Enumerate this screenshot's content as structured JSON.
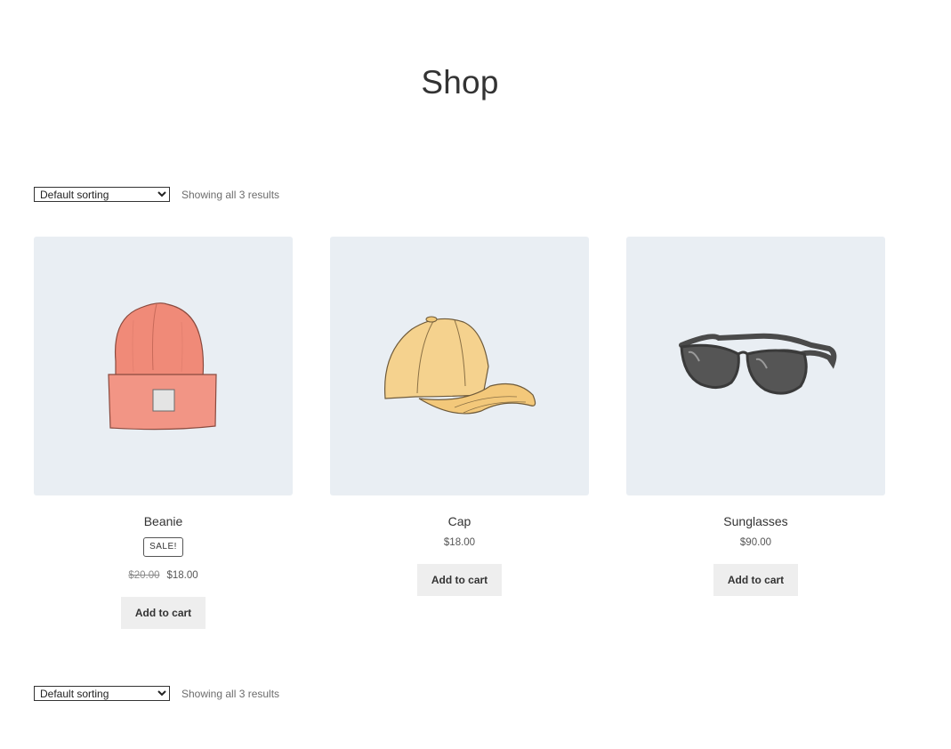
{
  "page": {
    "title": "Shop"
  },
  "toolbar_top": {
    "sort_selected": "Default sorting",
    "result_count": "Showing all 3 results"
  },
  "toolbar_bottom": {
    "sort_selected": "Default sorting",
    "result_count": "Showing all 3 results"
  },
  "products": [
    {
      "name": "Beanie",
      "icon": "beanie-hat-image",
      "sale_badge": "SALE!",
      "old_price": "$20.00",
      "price": "$18.00",
      "button_label": "Add to cart"
    },
    {
      "name": "Cap",
      "icon": "baseball-cap-image",
      "price": "$18.00",
      "button_label": "Add to cart"
    },
    {
      "name": "Sunglasses",
      "icon": "sunglasses-image",
      "price": "$90.00",
      "button_label": "Add to cart"
    }
  ],
  "colors": {
    "image_background": "#e9eef3",
    "button_background": "#eeeeee",
    "beanie": "#f08a78",
    "cap": "#f5d28e",
    "sunglasses": "#7a7a7a"
  }
}
